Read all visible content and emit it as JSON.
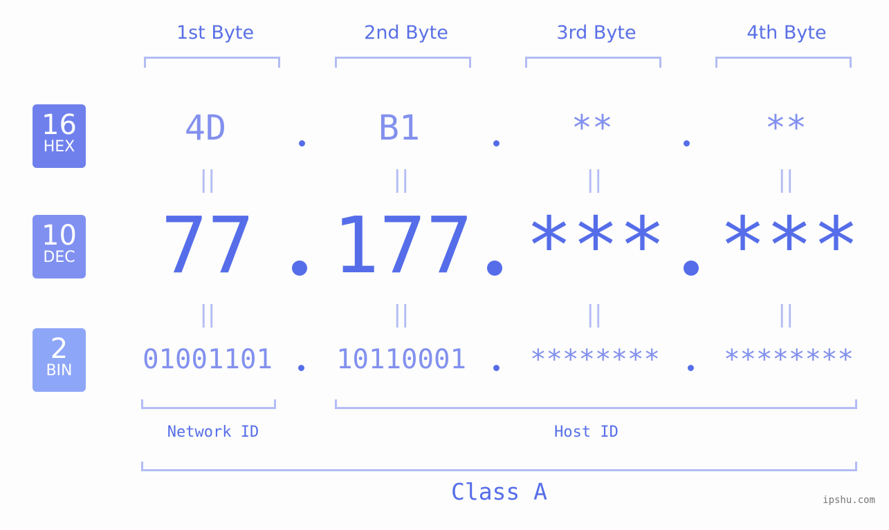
{
  "bytes": [
    {
      "header": "1st Byte",
      "hex": "4D",
      "dec": "77",
      "bin": "01001101"
    },
    {
      "header": "2nd Byte",
      "hex": "B1",
      "dec": "177",
      "bin": "10110001"
    },
    {
      "header": "3rd Byte",
      "hex": "**",
      "dec": "***",
      "bin": "********"
    },
    {
      "header": "4th Byte",
      "hex": "**",
      "dec": "***",
      "bin": "********"
    }
  ],
  "bases": {
    "hex": {
      "number": "16",
      "label": "HEX",
      "color": "#6f80ec"
    },
    "dec": {
      "number": "10",
      "label": "DEC",
      "color": "#8090f0"
    },
    "bin": {
      "number": "2",
      "label": "BIN",
      "color": "#8ea6f8"
    }
  },
  "equals_symbol": "||",
  "network_label": "Network ID",
  "host_label": "Host ID",
  "class_label": "Class A",
  "watermark": "ipshu.com"
}
